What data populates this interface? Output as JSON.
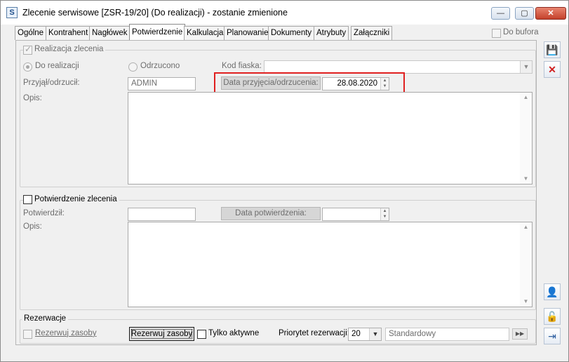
{
  "window": {
    "title": "Zlecenie serwisowe [ZSR-19/20] (Do realizacji) - zostanie zmienione",
    "app_icon": "S",
    "controls": {
      "minimize": "—",
      "maximize": "▢",
      "close": "✕"
    }
  },
  "tabs": [
    {
      "label": "Ogólne"
    },
    {
      "label": "Kontrahent"
    },
    {
      "label": "Nagłówek"
    },
    {
      "label": "Potwierdzenie"
    },
    {
      "label": "Kalkulacja"
    },
    {
      "label": "Planowanie"
    },
    {
      "label": "Dokumenty"
    },
    {
      "label": "Atrybuty"
    },
    {
      "label": "Załączniki"
    }
  ],
  "active_tab": "Potwierdzenie",
  "do_bufora": {
    "label": "Do bufora",
    "checked": false
  },
  "realizacja": {
    "legend": "Realizacja zlecenia",
    "checked": true,
    "radio_do_realizacji": "Do realizacji",
    "radio_odrzucono": "Odrzucono",
    "selected": "Do realizacji",
    "kod_fiaska_label": "Kod fiaska:",
    "kod_fiaska_value": "",
    "przyjal_label": "Przyjął/odrzucił:",
    "przyjal_value": "ADMIN",
    "data_btn_label": "Data przyjęcia/odrzucenia:",
    "data_value": "28.08.2020",
    "opis_label": "Opis:",
    "opis_value": ""
  },
  "potwierdzenie": {
    "legend": "Potwierdzenie zlecenia",
    "checked": false,
    "potwierdzil_label": "Potwierdził:",
    "potwierdzil_value": "",
    "data_btn_label": "Data potwierdzenia:",
    "data_value": "",
    "opis_label": "Opis:",
    "opis_value": ""
  },
  "rezerwacje": {
    "legend": "Rezerwacje",
    "rezerwuj_checkbox_label": "Rezerwuj zasoby",
    "rezerwuj_checked": false,
    "rezerwuj_button_label": "Rezerwuj zasoby",
    "tylko_aktywne_label": "Tylko aktywne",
    "tylko_aktywne_checked": false,
    "priorytet_label": "Priorytet rezerwacji:",
    "priorytet_value": "20",
    "priorytet_name": "Standardowy"
  },
  "highlight_color": "#e02020"
}
